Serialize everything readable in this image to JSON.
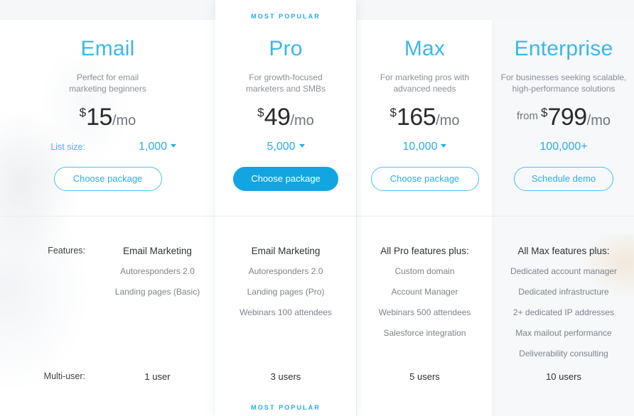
{
  "badge": {
    "text": "MOST POPULAR"
  },
  "labels": {
    "list_size": "List size:",
    "features": "Features:",
    "multi_user": "Multi-user:"
  },
  "currency": "$",
  "per_month": "/mo",
  "from_prefix": "from",
  "plans": [
    {
      "id": "email",
      "name": "Email",
      "description_line1": "Perfect for email",
      "description_line2": "marketing beginners",
      "price": "15",
      "currency": "$",
      "period": "/mo",
      "list_size": "1,000",
      "list_size_has_caret": true,
      "cta": "Choose package",
      "cta_style": "outline",
      "features_heading": "Email Marketing",
      "features": [
        "Autoresponders 2.0",
        "Landing pages (Basic)"
      ],
      "multi_user": "1 user",
      "featured": false
    },
    {
      "id": "pro",
      "name": "Pro",
      "description_line1": "For growth-focused",
      "description_line2": "marketers and SMBs",
      "price": "49",
      "currency": "$",
      "period": "/mo",
      "list_size": "5,000",
      "list_size_has_caret": true,
      "cta": "Choose package",
      "cta_style": "solid",
      "features_heading": "Email Marketing",
      "features": [
        "Autoresponders 2.0",
        "Landing pages (Pro)",
        "Webinars 100 attendees"
      ],
      "multi_user": "3 users",
      "featured": true,
      "badge_top": "MOST POPULAR",
      "badge_bottom": "MOST POPULAR"
    },
    {
      "id": "max",
      "name": "Max",
      "description_line1": "For marketing pros with",
      "description_line2": "advanced needs",
      "price": "165",
      "currency": "$",
      "period": "/mo",
      "list_size": "10,000",
      "list_size_has_caret": true,
      "cta": "Choose package",
      "cta_style": "outline",
      "features_heading": "All Pro features plus:",
      "features": [
        "Custom domain",
        "Account Manager",
        "Webinars 500 attendees",
        "Salesforce integration"
      ],
      "multi_user": "5 users",
      "featured": false
    },
    {
      "id": "enterprise",
      "name": "Enterprise",
      "description_line1": "For businesses seeking scalable,",
      "description_line2": "high-performance solutions",
      "price": "799",
      "currency": "$",
      "period": "/mo",
      "price_prefix": "from",
      "list_size": "100,000+",
      "list_size_has_caret": false,
      "cta": "Schedule demo",
      "cta_style": "outline",
      "features_heading": "All Max features plus:",
      "features": [
        "Dedicated account manager",
        "Dedicated infrastructure",
        "2+ dedicated IP addresses",
        "Max mailout performance",
        "Deliverability consulting"
      ],
      "multi_user": "10 users",
      "featured": false
    }
  ],
  "colors": {
    "accent": "#2aaee4",
    "accent_light": "#3cb7ea",
    "solid_button": "#12a5e2",
    "badge": "#22aee5",
    "text_dark": "#2e3236",
    "text_muted": "#7e848a",
    "card_bg": "#ffffff",
    "enterprise_bg": "#f6f8fa",
    "top_band": "#f5f7f9",
    "divider": "#ececec"
  }
}
